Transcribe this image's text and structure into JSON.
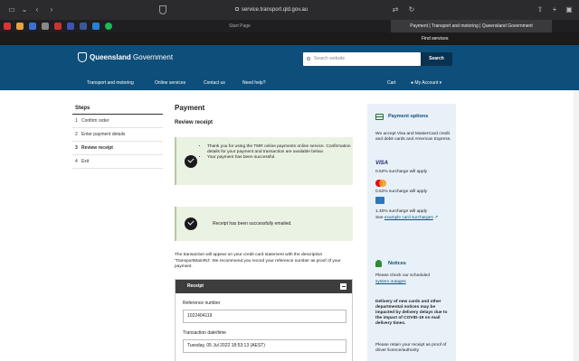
{
  "browser": {
    "url": "service.transport.qld.gov.au",
    "tabs": [
      {
        "label": "Start Page",
        "active": false
      },
      {
        "label": "Payment | Transport and motoring | Queensland Government",
        "active": true
      }
    ]
  },
  "top_strip": {
    "find_services": "Find services"
  },
  "header": {
    "logo_name": "Queensland",
    "logo_suffix": "Government",
    "search_placeholder": "Search website",
    "search_button": "Search",
    "nav": [
      "Transport and motoring",
      "Online services",
      "Contact us",
      "Need help?"
    ],
    "cart": "Cart",
    "account": "My Account"
  },
  "steps": {
    "title": "Steps",
    "items": [
      {
        "num": "1",
        "label": "Confirm order"
      },
      {
        "num": "2",
        "label": "Enter payment details"
      },
      {
        "num": "3",
        "label": "Review receipt"
      },
      {
        "num": "4",
        "label": "Exit"
      }
    ]
  },
  "main": {
    "title": "Payment",
    "subtitle": "Review receipt",
    "notice1": [
      "Thank you for using the TMR online payments online service. Confirmation details for your payment and transaction are available below.",
      "Your payment has been successful."
    ],
    "notice2": "Receipt has been successfully emailed.",
    "paragraph": "The transaction will appear on your credit card statement with the description 'TransportMainRd'. We recommend you record your reference number as proof of your payment.",
    "receipt": {
      "title": "Receipt",
      "ref_label": "Reference number",
      "ref_value": "1022404119",
      "date_label": "Transaction date/time",
      "date_value": "Tuesday, 05 Jul 2022 18:53:13 (AEST)"
    }
  },
  "sidebar": {
    "payment_title": "Payment options",
    "payment_intro": "We accept Visa and MasterCard credit and debit cards and American Express.",
    "visa_label": "VISA",
    "visa_fee": "0.52% surcharge will apply",
    "mc_fee": "0.52% surcharge will apply",
    "amex_fee": "1.40% surcharge will apply",
    "see_prefix": "See",
    "see_link": "example card surcharges",
    "notices_title": "Notices",
    "notice_check": "Please check our scheduled",
    "notice_link": "system outages",
    "delivery": "Delivery of new cards and other departmental notices may be impacted by delivery delays due to the impact of COVID-19 on mail delivery times.",
    "retain": "Please retain your receipt as proof of driver licence/authority"
  },
  "colors": {
    "header_bg": "#0e4e7a",
    "notice_bg": "#eaf2e3",
    "sidebar_bg": "#e8f1f8"
  }
}
